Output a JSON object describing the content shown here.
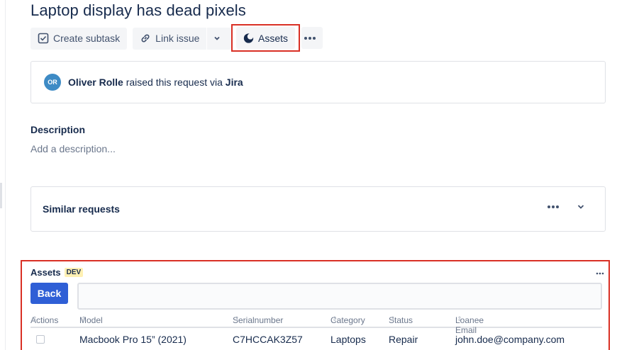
{
  "issue": {
    "title": "Laptop display has dead pixels"
  },
  "toolbar": {
    "create_subtask": "Create subtask",
    "link_issue": "Link issue",
    "assets": "Assets",
    "icons": [
      "subtask-icon",
      "link-icon",
      "chevron-down-icon",
      "assets-icon",
      "more-icon"
    ]
  },
  "request": {
    "avatar_initials": "OR",
    "requester": "Oliver Rolle",
    "middle_text": " raised this request via ",
    "channel": "Jira",
    "avatar_color": "#3E8BC5"
  },
  "description": {
    "label": "Description",
    "placeholder": "Add a description..."
  },
  "similar": {
    "title": "Similar requests"
  },
  "assets_panel": {
    "title": "Assets",
    "badge": "DEV",
    "back_label": "Back",
    "search_value": "",
    "columns": [
      "Actions",
      "Model",
      "Serialnumber",
      "Category",
      "Status",
      "Loanee Email"
    ],
    "rows": [
      {
        "model": "Macbook Pro 15” (2021)",
        "serial": "C7HCCAK3Z57",
        "category": "Laptops",
        "status": "Repair",
        "email": "john.doe@company.com"
      }
    ]
  },
  "colors": {
    "accent": "#2F5FD6",
    "highlight": "#D93025",
    "badge_bg": "#FFF0B3"
  }
}
